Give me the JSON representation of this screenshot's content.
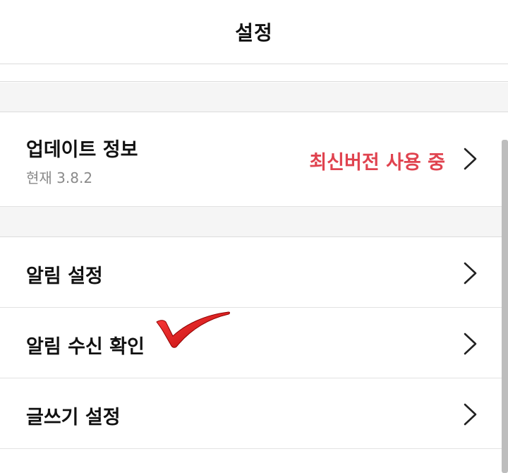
{
  "header": {
    "title": "설정"
  },
  "update_row": {
    "title": "업데이트 정보",
    "subtitle": "현재 3.8.2",
    "status": "최신버전 사용 중",
    "status_color": "#e0434f"
  },
  "menu": {
    "alarm_settings": "알림 설정",
    "alarm_check": "알림 수신 확인",
    "writing_settings": "글쓰기 설정"
  },
  "icons": {
    "chevron": "chevron-right-icon",
    "annotation": "red-checkmark-icon"
  }
}
